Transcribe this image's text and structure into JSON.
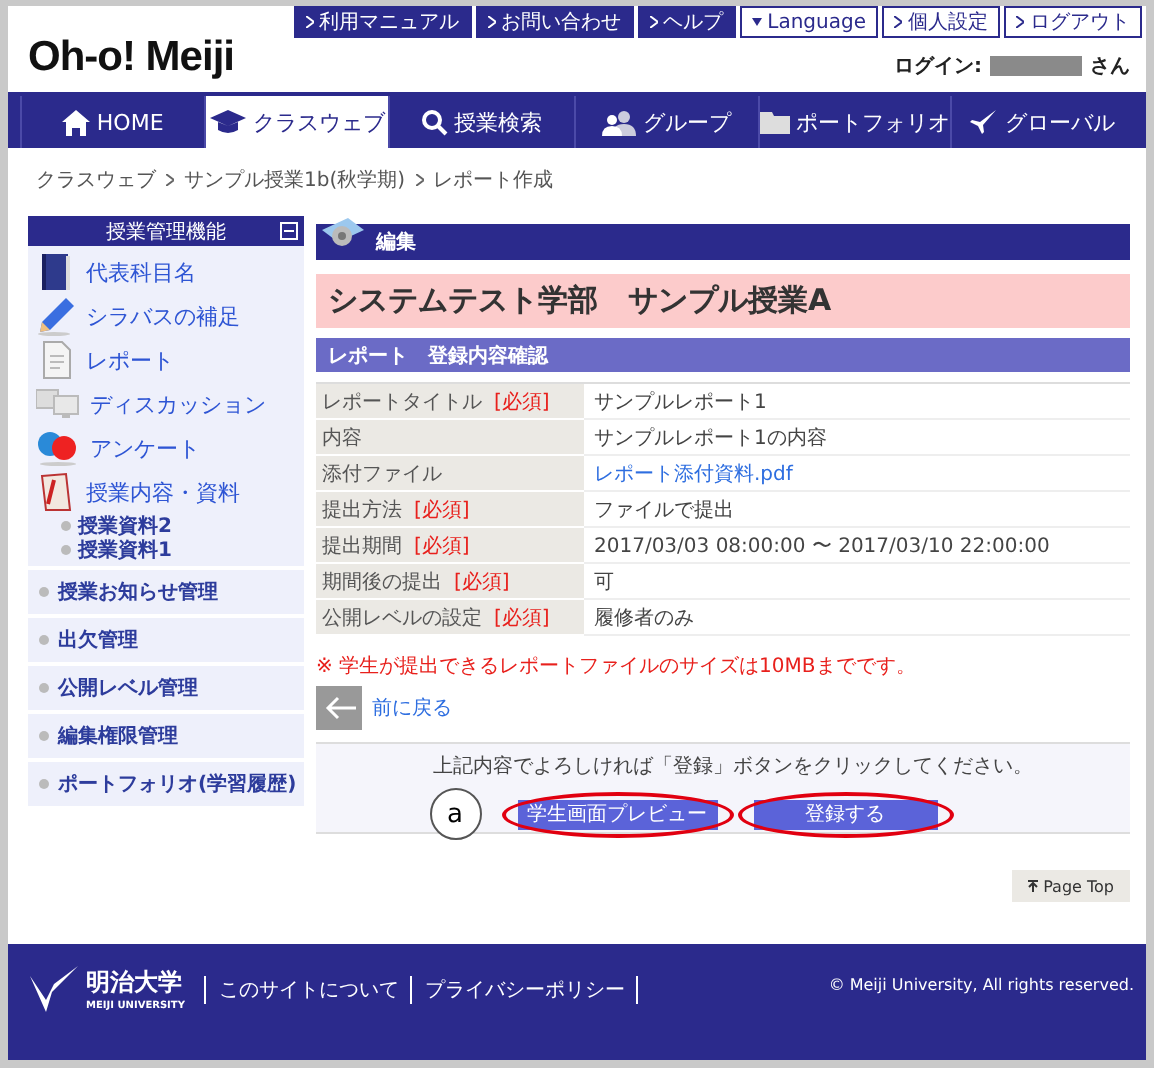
{
  "header": {
    "logo": "Oh-o! Meiji",
    "login_label": "ログイン:",
    "login_suffix": "さん",
    "utility_links": [
      {
        "label": "利用マニュアル",
        "kind": "dark"
      },
      {
        "label": "お問い合わせ",
        "kind": "dark"
      },
      {
        "label": "ヘルプ",
        "kind": "dark"
      },
      {
        "label": "Language",
        "kind": "select"
      },
      {
        "label": "個人設定",
        "kind": "light"
      },
      {
        "label": "ログアウト",
        "kind": "light"
      }
    ]
  },
  "nav": [
    {
      "label": "HOME",
      "selected": false
    },
    {
      "label": "クラスウェブ",
      "selected": true
    },
    {
      "label": "授業検索",
      "selected": false
    },
    {
      "label": "グループ",
      "selected": false
    },
    {
      "label": "ポートフォリオ",
      "selected": false
    },
    {
      "label": "グローバル",
      "selected": false
    }
  ],
  "breadcrumb": [
    "クラスウェブ",
    "サンプル授業1b(秋学期)",
    "レポート作成"
  ],
  "sidebar": {
    "title": "授業管理機能",
    "items": [
      {
        "label": "代表科目名"
      },
      {
        "label": "シラバスの補足"
      },
      {
        "label": "レポート"
      },
      {
        "label": "ディスカッション"
      },
      {
        "label": "アンケート"
      },
      {
        "label": "授業内容・資料",
        "children": [
          {
            "label": "授業資料2"
          },
          {
            "label": "授業資料1"
          }
        ]
      }
    ],
    "sections": [
      "授業お知らせ管理",
      "出欠管理",
      "公開レベル管理",
      "編集権限管理",
      "ポートフォリオ(学習履歴)"
    ]
  },
  "main": {
    "section_label": "編集",
    "course_title": "システムテスト学部　サンプル授業A",
    "subheading": "レポート　登録内容確認",
    "rows": [
      {
        "label": "レポートタイトル",
        "required_tag": "[必須]",
        "value": "サンプルレポート1",
        "kind": "text"
      },
      {
        "label": "内容",
        "value": "サンプルレポート1の内容",
        "kind": "text"
      },
      {
        "label": "添付ファイル",
        "value": "レポート添付資料.pdf",
        "kind": "link"
      },
      {
        "label": "提出方法",
        "required_tag": "[必須]",
        "value": "ファイルで提出",
        "kind": "text"
      },
      {
        "label": "提出期間",
        "required_tag": "[必須]",
        "value": "2017/03/03 08:00:00 〜 2017/03/10 22:00:00",
        "kind": "text"
      },
      {
        "label": "期間後の提出",
        "required_tag": "[必須]",
        "value": "可",
        "kind": "text"
      },
      {
        "label": "公開レベルの設定",
        "required_tag": "[必須]",
        "value": "履修者のみ",
        "kind": "text"
      }
    ],
    "note": "※ 学生が提出できるレポートファイルのサイズは10MBまでです。",
    "back_link": "前に戻る",
    "confirm_text": "上記内容でよろしければ「登録」ボタンをクリックしてください。",
    "annotation": "a",
    "buttons": [
      {
        "label": "学生画面プレビュー",
        "highlighted": true
      },
      {
        "label": "登録する",
        "highlighted": true
      }
    ],
    "page_top": "Page Top"
  },
  "footer": {
    "logo_name": "明治大学",
    "logo_sub": "MEIJI UNIVERSITY",
    "links": [
      "このサイトについて",
      "プライバシーポリシー"
    ],
    "copyright": "© Meiji University, All rights reserved."
  }
}
